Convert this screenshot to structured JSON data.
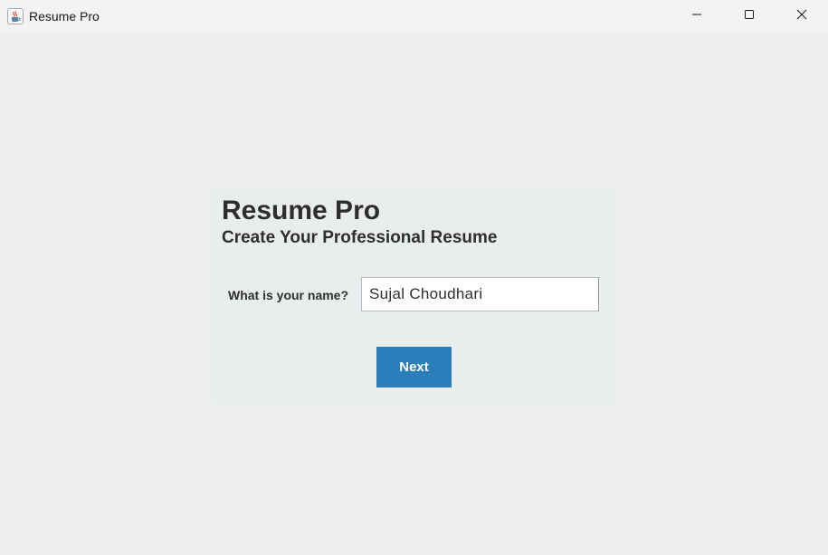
{
  "window": {
    "title": "Resume Pro",
    "app_icon": "java-cup-icon",
    "controls": {
      "minimize_icon": "minimize-icon",
      "maximize_icon": "maximize-icon",
      "close_icon": "close-icon"
    }
  },
  "header": {
    "title": "Resume Pro",
    "subtitle": "Create Your Professional Resume"
  },
  "form": {
    "name_label": "What is your name?",
    "name_value": "Sujal Choudhari",
    "next_label": "Next"
  },
  "colors": {
    "background": "#eeeeee",
    "panel": "#eaedee",
    "accent": "#2a7fbb",
    "text": "#2e2e2e"
  }
}
